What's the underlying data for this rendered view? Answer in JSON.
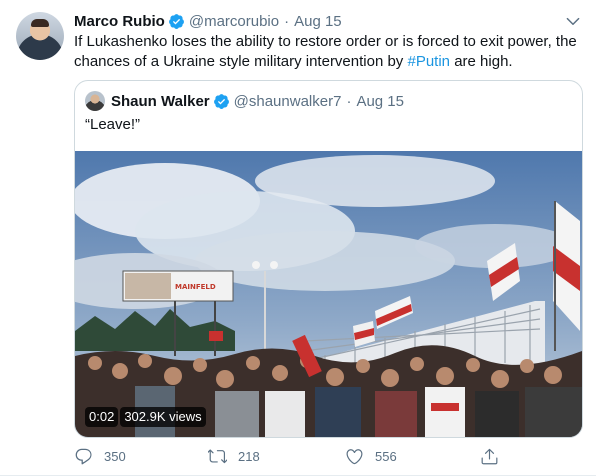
{
  "tweet": {
    "author_name": "Marco Rubio",
    "author_handle": "@marcorubio",
    "separator": "·",
    "date": "Aug 15",
    "text_before_hashtag": "If Lukashenko loses the ability to restore order or is forced to exit power, the chances of a Ukraine style military intervention by ",
    "hashtag": "#Putin",
    "text_after_hashtag": " are high."
  },
  "quoted": {
    "author_name": "Shaun Walker",
    "author_handle": "@shaunwalker7",
    "separator": "·",
    "date": "Aug 15",
    "text": "“Leave!”",
    "video": {
      "time": "0:02",
      "views": "302.9K views",
      "billboard_text": "MAINFELD"
    }
  },
  "actions": {
    "reply_count": "350",
    "retweet_count": "218",
    "like_count": "556"
  },
  "colors": {
    "verified": "#1da1f2",
    "link": "#1b95e0",
    "muted": "#5b7083"
  },
  "icons": [
    "verified-badge-icon",
    "chevron-down-icon",
    "reply-icon",
    "retweet-icon",
    "like-icon",
    "share-icon"
  ]
}
